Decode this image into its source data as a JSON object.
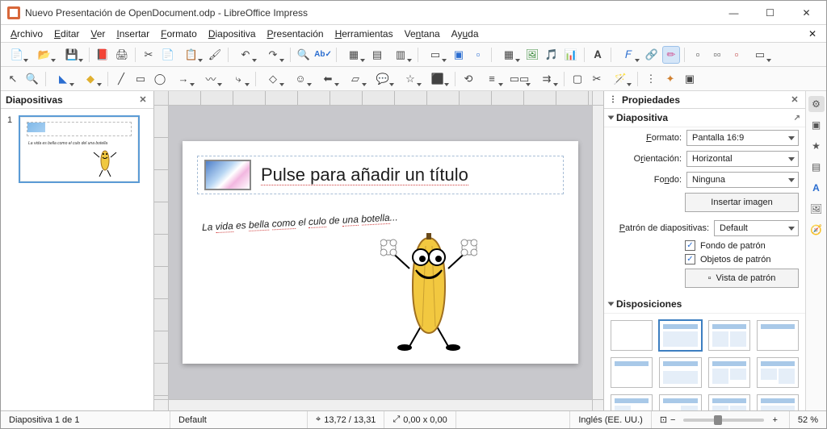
{
  "title_bar": {
    "filename": "Nuevo Presentación de OpenDocument.odp",
    "app": "LibreOffice Impress"
  },
  "menus": [
    "Archivo",
    "Editar",
    "Ver",
    "Insertar",
    "Formato",
    "Diapositiva",
    "Presentación",
    "Herramientas",
    "Ventana",
    "Ayuda"
  ],
  "slides_panel": {
    "title": "Diapositivas",
    "thumb_text": "La vida es bella como el culo del una botella"
  },
  "slide": {
    "title_placeholder": "Pulse para añadir un título",
    "body_text": "La vida es bella como el culo de una botella..."
  },
  "properties": {
    "title": "Propiedades",
    "slide_section": "Diapositiva",
    "format_label": "Formato:",
    "format_value": "Pantalla 16:9",
    "orientation_label": "Orientación:",
    "orientation_value": "Horizontal",
    "background_label": "Fondo:",
    "background_value": "Ninguna",
    "insert_image": "Insertar imagen",
    "master_label": "Patrón de diapositivas:",
    "master_value": "Default",
    "master_bg": "Fondo de patrón",
    "master_objects": "Objetos de patrón",
    "master_view": "Vista de patrón",
    "layouts_section": "Disposiciones"
  },
  "statusbar": {
    "slide_count": "Diapositiva 1 de 1",
    "template": "Default",
    "pos": "13,72 / 13,31",
    "size": "0,00 x 0,00",
    "lang": "Inglés (EE. UU.)",
    "zoom": "52 %"
  }
}
